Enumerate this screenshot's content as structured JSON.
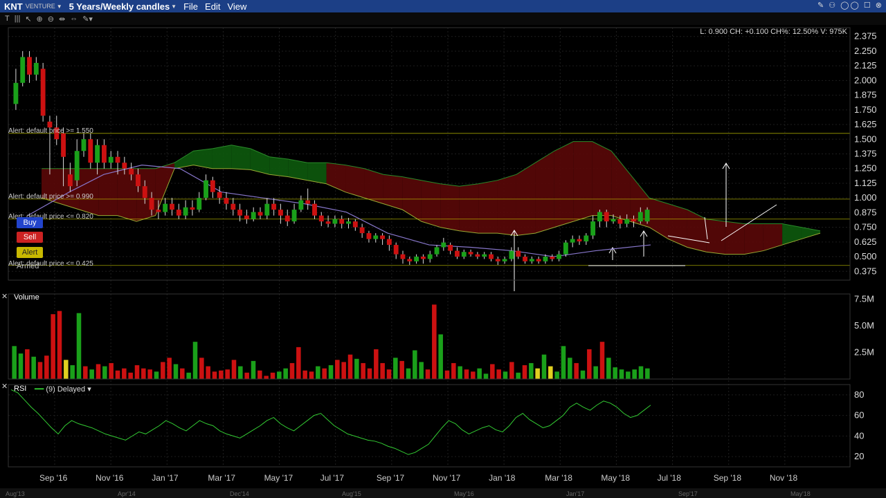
{
  "window": {
    "symbol": "KNT",
    "exchange": "VENTURE",
    "period": "5 Years/Weekly candles",
    "menu": [
      "File",
      "Edit",
      "View"
    ]
  },
  "info_bar": "L: 0.900 CH: +0.100 CH%: 12.50% V: 975K",
  "buttons": {
    "buy": "Buy",
    "sell": "Sell",
    "alert": "Alert",
    "armed": "Armed"
  },
  "alerts": [
    {
      "label": "Alert: default price >= 1.550",
      "price": 1.55
    },
    {
      "label": "Alert: default price >= 0.990",
      "price": 0.99
    },
    {
      "label": "Alert: default price <= 0.820",
      "price": 0.82
    },
    {
      "label": "Alert: default price <= 0.425",
      "price": 0.425
    }
  ],
  "panels": {
    "volume_title": "Volume",
    "rsi_title": "RSI",
    "rsi_params": "(9) Delayed"
  },
  "colors": {
    "up": "#1aa01a",
    "down": "#cc1111",
    "neutral": "#e0d020",
    "cloud_bull": "#0d5a0d",
    "cloud_bear": "#5a0808",
    "ma": "#8877cc",
    "rsi": "#33cc33"
  },
  "chart_data": {
    "type": "candlestick",
    "price_axis": {
      "min": 0.3,
      "max": 2.45,
      "ticks": [
        2.375,
        2.25,
        2.125,
        2.0,
        1.875,
        1.75,
        1.625,
        1.5,
        1.375,
        1.25,
        1.125,
        1.0,
        0.875,
        0.75,
        0.625,
        0.5,
        0.375
      ]
    },
    "price_tick_labels": [
      "2.375",
      "2.250",
      "2.125",
      "2.000",
      "1.875",
      "1.750",
      "1.625",
      "1.500",
      "1.375",
      "1.250",
      "1.125",
      "1.000",
      "0.875",
      "0.750",
      "0.625",
      "0.500",
      "0.375"
    ],
    "volume_axis": {
      "min": 0,
      "max": 8000000,
      "ticks": [
        "7.5M",
        "5.0M",
        "2.5M"
      ]
    },
    "rsi_axis": {
      "min": 10,
      "max": 90,
      "ticks": [
        "80",
        "60",
        "40",
        "20"
      ]
    },
    "x_axis_labels": [
      "Sep '16",
      "Nov '16",
      "Jan '17",
      "Mar '17",
      "May '17",
      "Jul '17",
      "Sep '17",
      "Nov '17",
      "Jan '18",
      "Mar '18",
      "May '18",
      "Jul '18",
      "Sep '18",
      "Nov '18"
    ],
    "overview_labels": [
      "Aug'13",
      "Apr'14",
      "Dec'14",
      "Aug'15",
      "May'16",
      "Jan'17",
      "Sep'17",
      "May'18"
    ],
    "candles": [
      [
        1.8,
        1.98,
        2.1,
        1.75
      ],
      [
        1.98,
        2.2,
        2.25,
        1.95
      ],
      [
        2.2,
        2.05,
        2.25,
        1.98
      ],
      [
        2.05,
        2.15,
        2.2,
        2.0
      ],
      [
        2.1,
        1.7,
        2.15,
        1.65
      ],
      [
        1.65,
        1.6,
        1.7,
        1.2
      ],
      [
        1.6,
        1.5,
        1.7,
        1.45
      ],
      [
        1.55,
        1.35,
        1.6,
        1.1
      ],
      [
        1.2,
        1.1,
        1.3,
        1.05
      ],
      [
        1.15,
        1.4,
        1.5,
        1.1
      ],
      [
        1.4,
        1.5,
        1.55,
        1.35
      ],
      [
        1.5,
        1.3,
        1.55,
        1.25
      ],
      [
        1.3,
        1.45,
        1.5,
        1.2
      ],
      [
        1.45,
        1.3,
        1.5,
        1.25
      ],
      [
        1.3,
        1.35,
        1.4,
        1.25
      ],
      [
        1.35,
        1.3,
        1.4,
        1.2
      ],
      [
        1.3,
        1.25,
        1.35,
        1.2
      ],
      [
        1.25,
        1.2,
        1.3,
        1.15
      ],
      [
        1.2,
        1.1,
        1.25,
        1.05
      ],
      [
        1.1,
        1.0,
        1.15,
        0.95
      ],
      [
        1.0,
        0.9,
        1.05,
        0.85
      ],
      [
        0.9,
        0.88,
        0.98,
        0.82
      ],
      [
        0.88,
        0.95,
        1.0,
        0.85
      ],
      [
        0.95,
        0.9,
        1.0,
        0.85
      ],
      [
        0.9,
        0.85,
        0.95,
        0.82
      ],
      [
        0.85,
        0.92,
        0.98,
        0.82
      ],
      [
        0.92,
        0.9,
        0.98,
        0.85
      ],
      [
        0.9,
        1.0,
        1.05,
        0.88
      ],
      [
        1.0,
        1.15,
        1.2,
        0.98
      ],
      [
        1.15,
        1.05,
        1.18,
        1.0
      ],
      [
        1.05,
        1.0,
        1.1,
        0.95
      ],
      [
        1.0,
        0.95,
        1.05,
        0.9
      ],
      [
        0.95,
        0.9,
        1.0,
        0.85
      ],
      [
        0.9,
        0.85,
        0.95,
        0.8
      ],
      [
        0.85,
        0.82,
        0.9,
        0.78
      ],
      [
        0.82,
        0.88,
        0.92,
        0.8
      ],
      [
        0.88,
        0.85,
        0.92,
        0.82
      ],
      [
        0.85,
        0.95,
        1.0,
        0.82
      ],
      [
        0.95,
        0.9,
        1.0,
        0.85
      ],
      [
        0.9,
        0.85,
        0.95,
        0.78
      ],
      [
        0.85,
        0.8,
        0.9,
        0.76
      ],
      [
        0.8,
        0.9,
        0.95,
        0.78
      ],
      [
        0.9,
        0.98,
        1.02,
        0.88
      ],
      [
        0.98,
        0.95,
        1.08,
        0.9
      ],
      [
        0.95,
        0.85,
        0.98,
        0.82
      ],
      [
        0.85,
        0.8,
        0.88,
        0.76
      ],
      [
        0.8,
        0.78,
        0.85,
        0.75
      ],
      [
        0.78,
        0.82,
        0.85,
        0.75
      ],
      [
        0.82,
        0.78,
        0.85,
        0.74
      ],
      [
        0.78,
        0.8,
        0.83,
        0.74
      ],
      [
        0.8,
        0.75,
        0.82,
        0.72
      ],
      [
        0.75,
        0.7,
        0.78,
        0.66
      ],
      [
        0.7,
        0.65,
        0.72,
        0.62
      ],
      [
        0.65,
        0.68,
        0.7,
        0.62
      ],
      [
        0.68,
        0.65,
        0.7,
        0.6
      ],
      [
        0.65,
        0.6,
        0.68,
        0.55
      ],
      [
        0.6,
        0.52,
        0.62,
        0.48
      ],
      [
        0.52,
        0.48,
        0.55,
        0.44
      ],
      [
        0.48,
        0.46,
        0.5,
        0.43
      ],
      [
        0.46,
        0.5,
        0.52,
        0.44
      ],
      [
        0.5,
        0.48,
        0.52,
        0.44
      ],
      [
        0.48,
        0.52,
        0.55,
        0.45
      ],
      [
        0.52,
        0.58,
        0.6,
        0.5
      ],
      [
        0.58,
        0.62,
        0.66,
        0.55
      ],
      [
        0.6,
        0.55,
        0.62,
        0.52
      ],
      [
        0.55,
        0.5,
        0.58,
        0.48
      ],
      [
        0.5,
        0.54,
        0.56,
        0.48
      ],
      [
        0.54,
        0.52,
        0.56,
        0.5
      ],
      [
        0.52,
        0.5,
        0.54,
        0.48
      ],
      [
        0.5,
        0.52,
        0.54,
        0.48
      ],
      [
        0.52,
        0.48,
        0.54,
        0.46
      ],
      [
        0.48,
        0.46,
        0.5,
        0.43
      ],
      [
        0.46,
        0.48,
        0.5,
        0.44
      ],
      [
        0.48,
        0.55,
        0.58,
        0.46
      ],
      [
        0.55,
        0.5,
        0.58,
        0.48
      ],
      [
        0.5,
        0.46,
        0.52,
        0.44
      ],
      [
        0.46,
        0.48,
        0.5,
        0.44
      ],
      [
        0.48,
        0.46,
        0.5,
        0.44
      ],
      [
        0.46,
        0.5,
        0.52,
        0.44
      ],
      [
        0.5,
        0.48,
        0.52,
        0.46
      ],
      [
        0.48,
        0.52,
        0.55,
        0.46
      ],
      [
        0.52,
        0.62,
        0.64,
        0.5
      ],
      [
        0.62,
        0.65,
        0.68,
        0.58
      ],
      [
        0.65,
        0.63,
        0.68,
        0.6
      ],
      [
        0.63,
        0.68,
        0.7,
        0.6
      ],
      [
        0.68,
        0.8,
        0.85,
        0.65
      ],
      [
        0.8,
        0.88,
        0.9,
        0.75
      ],
      [
        0.88,
        0.8,
        0.9,
        0.75
      ],
      [
        0.8,
        0.82,
        0.86,
        0.78
      ],
      [
        0.82,
        0.78,
        0.85,
        0.74
      ],
      [
        0.78,
        0.82,
        0.86,
        0.75
      ],
      [
        0.82,
        0.8,
        0.85,
        0.75
      ],
      [
        0.8,
        0.88,
        0.92,
        0.78
      ],
      [
        0.8,
        0.9,
        0.92,
        0.78
      ]
    ],
    "volume_millions": [
      3.1,
      2.4,
      2.8,
      2.1,
      1.6,
      2.2,
      6.1,
      6.4,
      1.8,
      1.3,
      6.2,
      1.2,
      0.9,
      1.4,
      1.2,
      1.5,
      0.8,
      1.0,
      0.6,
      1.3,
      1.0,
      0.9,
      0.7,
      1.6,
      2.0,
      1.4,
      1.0,
      0.6,
      3.5,
      2.0,
      1.2,
      0.7,
      0.8,
      0.9,
      1.8,
      1.2,
      0.6,
      1.7,
      0.8,
      0.3,
      0.6,
      0.7,
      1.0,
      1.5,
      3.0,
      0.8,
      0.7,
      1.2,
      1.0,
      1.3,
      1.8,
      1.6,
      2.3,
      1.9,
      1.5,
      1.0,
      2.8,
      1.5,
      0.9,
      2.0,
      1.7,
      1.0,
      2.7,
      1.6,
      0.9,
      7.0,
      4.2,
      0.8,
      1.5,
      1.2,
      0.9,
      0.7,
      1.0,
      0.5,
      1.4,
      0.9,
      0.7,
      1.6,
      0.6,
      1.3,
      1.5,
      1.0,
      2.3,
      1.2,
      0.7,
      3.1,
      2.0,
      1.5,
      0.8,
      2.8,
      1.2,
      3.5,
      2.0,
      1.1,
      0.9,
      0.7,
      0.9,
      1.2,
      1.0
    ],
    "rsi": [
      85,
      82,
      75,
      68,
      62,
      55,
      48,
      42,
      50,
      55,
      52,
      50,
      48,
      45,
      42,
      40,
      38,
      36,
      40,
      44,
      42,
      46,
      50,
      55,
      52,
      48,
      45,
      50,
      55,
      52,
      50,
      45,
      42,
      40,
      38,
      42,
      46,
      50,
      55,
      58,
      52,
      48,
      45,
      50,
      55,
      60,
      62,
      56,
      50,
      46,
      42,
      40,
      38,
      36,
      35,
      33,
      30,
      28,
      25,
      22,
      24,
      28,
      32,
      40,
      48,
      55,
      52,
      46,
      42,
      45,
      48,
      50,
      46,
      44,
      50,
      58,
      62,
      56,
      52,
      48,
      50,
      55,
      60,
      68,
      72,
      68,
      65,
      70,
      74,
      72,
      68,
      62,
      58,
      60,
      65,
      70
    ]
  }
}
